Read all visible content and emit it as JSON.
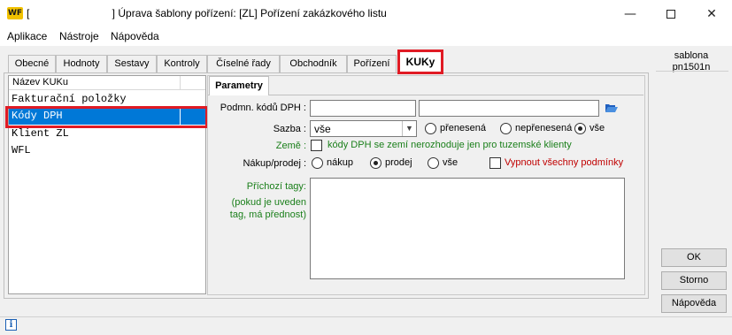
{
  "window": {
    "logo": "WF",
    "title": "[                            ] Úprava šablony pořízení: [ZL] Pořízení zakázkového listu"
  },
  "menu": [
    "Aplikace",
    "Nástroje",
    "Nápověda"
  ],
  "tabs": [
    "Obecné",
    "Hodnoty",
    "Sestavy",
    "Kontroly",
    "Číselné řady",
    "Obchodník",
    "Pořízení",
    "KUKy"
  ],
  "active_tab": "KUKy",
  "list": {
    "header": "Název KUKu",
    "items": [
      "Fakturační položky",
      "Kódy DPH",
      "Klient ZL",
      "WFL"
    ],
    "selected": "Kódy DPH"
  },
  "parametry": {
    "tab_label": "Parametry",
    "podmn_label": "Podmn. kódů DPH :",
    "podmn_value": "",
    "podmn_value2": "",
    "sazba_label": "Sazba :",
    "sazba_value": "vše",
    "sazba_options": [
      "přenesená",
      "nepřenesená",
      "vše"
    ],
    "sazba_selected": "vše",
    "zeme_label": "Země :",
    "zeme_checkbox": "kódy DPH se zemí nerozhoduje jen pro tuzemské klienty",
    "nakup_label": "Nákup/prodej :",
    "nakup_options": [
      "nákup",
      "prodej",
      "vše"
    ],
    "nakup_selected": "prodej",
    "vypnout_label": "Vypnout všechny podmínky",
    "prichozi_label": "Příchozí tagy:",
    "prichozi_note": "(pokud je uveden tag, má přednost)",
    "prichozi_value": ""
  },
  "side": {
    "sablona_line1": "sablona",
    "sablona_line2": "pn1501n",
    "ok": "OK",
    "storno": "Storno",
    "napoveda": "Nápověda"
  },
  "colors": {
    "selection": "#0078d7",
    "highlight_box": "#e01b24",
    "green_label": "#1a7f1a",
    "red_label": "#c00000"
  },
  "icons": {
    "folder": "folder-open-icon",
    "info": "info-icon"
  }
}
